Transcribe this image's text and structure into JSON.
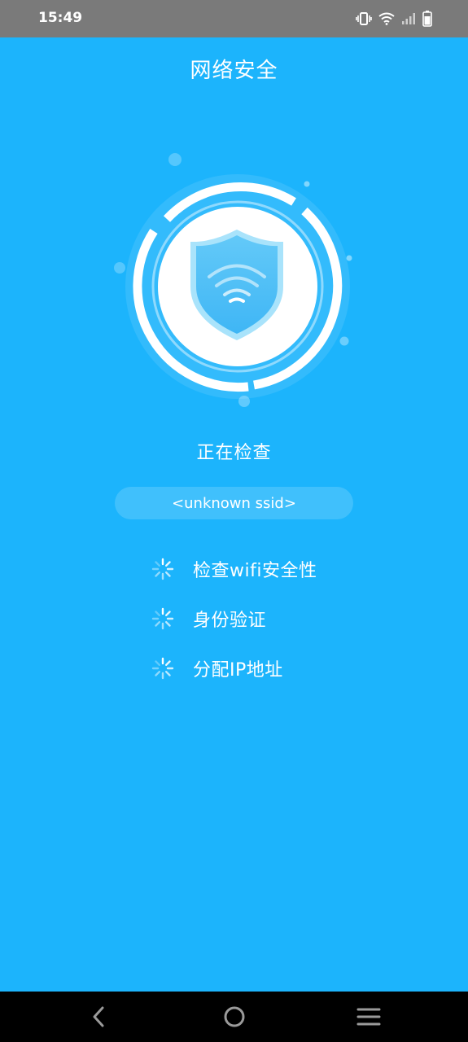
{
  "status_bar": {
    "time": "15:49",
    "icons": [
      "vibrate-icon",
      "wifi-icon",
      "cell-signal-icon",
      "battery-icon"
    ]
  },
  "page": {
    "title": "网络安全"
  },
  "hero": {
    "icon": "wifi-shield-icon",
    "ring_color": "#ffffff",
    "shield_color": "#4FC3F7"
  },
  "scan": {
    "status": "正在检查",
    "ssid": "<unknown ssid>",
    "items": [
      {
        "label": "检查wifi安全性",
        "icon": "loading-spinner-icon"
      },
      {
        "label": "身份验证",
        "icon": "loading-spinner-icon"
      },
      {
        "label": "分配IP地址",
        "icon": "loading-spinner-icon"
      }
    ]
  },
  "nav_bar": {
    "buttons": [
      "back-icon",
      "home-icon",
      "menu-icon"
    ]
  },
  "colors": {
    "background": "#1CB4FC",
    "status_bar": "#7a7a7a",
    "nav_bar": "#000000"
  }
}
